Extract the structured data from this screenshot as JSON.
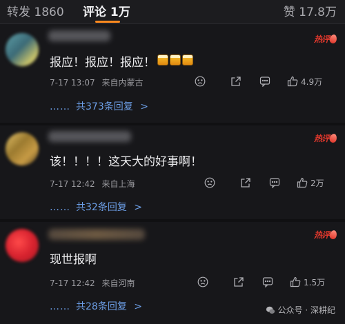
{
  "tabs": {
    "repost": "转发 1860",
    "comments": "评论 1万",
    "likes": "赞 17.8万"
  },
  "hot_label": "热评",
  "comments": [
    {
      "text": "报应！报应！报应！",
      "emoji": "beer-cheers x3",
      "date": "7-17 13:07",
      "location": "来自内蒙古",
      "likes": "4.9万",
      "replies": "共373条回复",
      "reply_arrow": ">"
    },
    {
      "text": "该！！！！这天大的好事啊！",
      "date": "7-17 12:42",
      "location": "来自上海",
      "likes": "2万",
      "replies": "共32条回复",
      "reply_arrow": ">"
    },
    {
      "text": "现世报啊",
      "date": "7-17 12:42",
      "location": "来自河南",
      "likes": "1.5万",
      "replies": "共28条回复",
      "reply_arrow": ">"
    }
  ],
  "reply_dots": "……",
  "watermark": "公众号 · 深耕纪",
  "colors": {
    "accent": "#ff8a1f",
    "link": "#6c9ee6",
    "hot": "#e0382c",
    "bg": "#17171a"
  }
}
